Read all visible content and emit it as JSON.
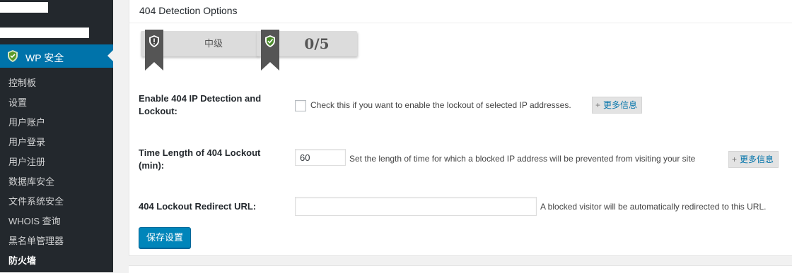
{
  "sidebar": {
    "active_menu": "WP 安全",
    "items": [
      {
        "label": "控制板"
      },
      {
        "label": "设置"
      },
      {
        "label": "用户账户"
      },
      {
        "label": "用户登录"
      },
      {
        "label": "用户注册"
      },
      {
        "label": "数据库安全"
      },
      {
        "label": "文件系统安全"
      },
      {
        "label": "WHOIS 查询"
      },
      {
        "label": "黑名单管理器"
      },
      {
        "label": "防火墙"
      }
    ]
  },
  "panel": {
    "title": "404 Detection Options",
    "badges": {
      "level": "中级",
      "score": "0/5"
    },
    "enable": {
      "label": "Enable 404 IP Detection and Lockout:",
      "description": "Check this if you want to enable the lockout of selected IP addresses.",
      "more": "更多信息"
    },
    "lockout_time": {
      "label": "Time Length of 404 Lockout (min):",
      "value": "60",
      "description": "Set the length of time for which a blocked IP address will be prevented from visiting your site",
      "more": "更多信息"
    },
    "redirect": {
      "label": "404 Lockout Redirect URL:",
      "value": "",
      "description": "A blocked visitor will be automatically redirected to this URL."
    },
    "save_label": "保存设置"
  },
  "colors": {
    "sidebar_bg": "#23282d",
    "active_blue": "#0073aa",
    "button_blue": "#0085ba",
    "shield_gray": "#5a5a5a",
    "shield_green": "#4a7c2a"
  }
}
